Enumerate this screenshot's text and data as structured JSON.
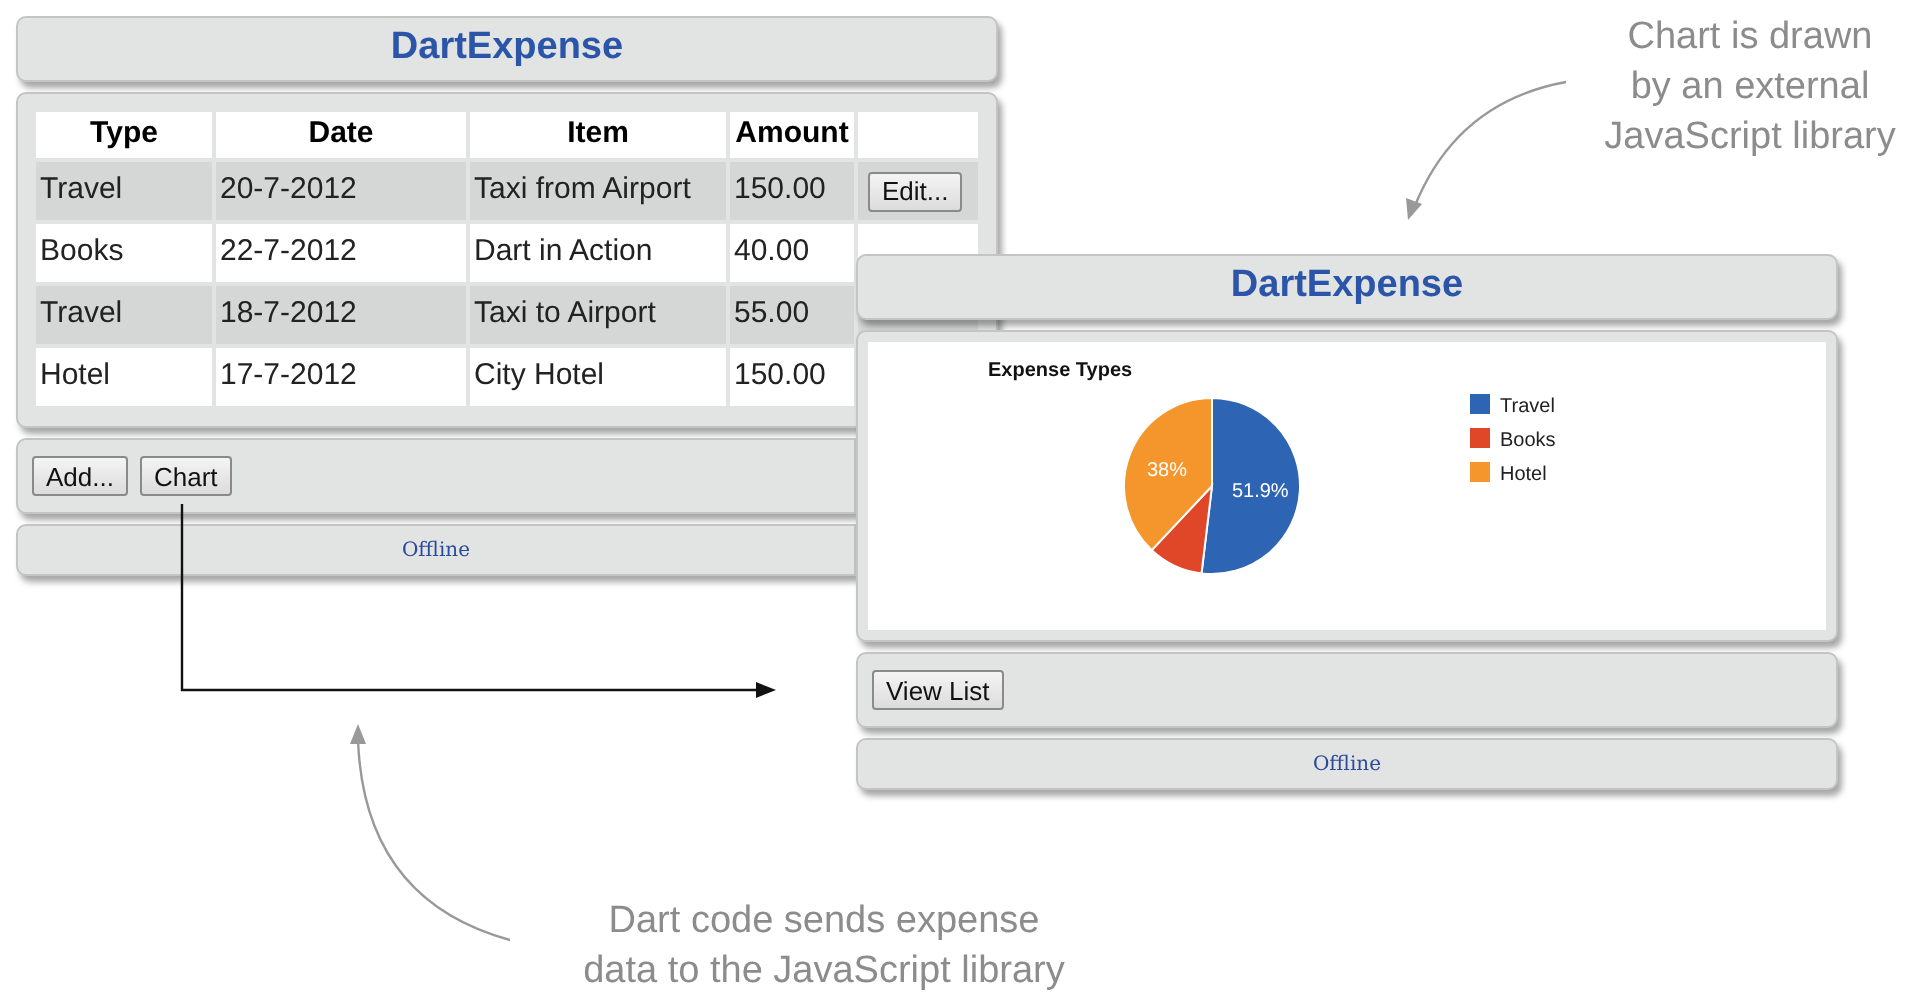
{
  "windows": [
    {
      "kind": "list",
      "title": "DartExpense",
      "table": {
        "columns": [
          "Type",
          "Date",
          "Item",
          "Amount"
        ],
        "rows": [
          {
            "cells": [
              "Travel",
              "20-7-2012",
              "Taxi from Airport",
              "150.00"
            ],
            "action": "Edit..."
          },
          {
            "cells": [
              "Books",
              "22-7-2012",
              "Dart in Action",
              "40.00"
            ]
          },
          {
            "cells": [
              "Travel",
              "18-7-2012",
              "Taxi to Airport",
              "55.00"
            ]
          },
          {
            "cells": [
              "Hotel",
              "17-7-2012",
              "City Hotel",
              "150.00"
            ]
          }
        ]
      },
      "buttons": [
        "Add...",
        "Chart"
      ],
      "status": "Offline"
    },
    {
      "kind": "chart",
      "title": "DartExpense",
      "chart_data": {
        "type": "pie",
        "title": "Expense Types",
        "categories": [
          "Travel",
          "Books",
          "Hotel"
        ],
        "values": [
          51.9,
          10.1,
          38
        ],
        "legend": "right",
        "colors": [
          "#2e64b4",
          "#e04628",
          "#f5962d"
        ],
        "value_labels": [
          "51.9%",
          null,
          "38%"
        ]
      },
      "buttons": [
        "View List"
      ],
      "status": "Offline"
    }
  ],
  "annotations": [
    {
      "text": "Chart is drawn\nby an external\nJavaScript library"
    },
    {
      "text": "Dart code sends expense\ndata to the JavaScript library"
    }
  ]
}
